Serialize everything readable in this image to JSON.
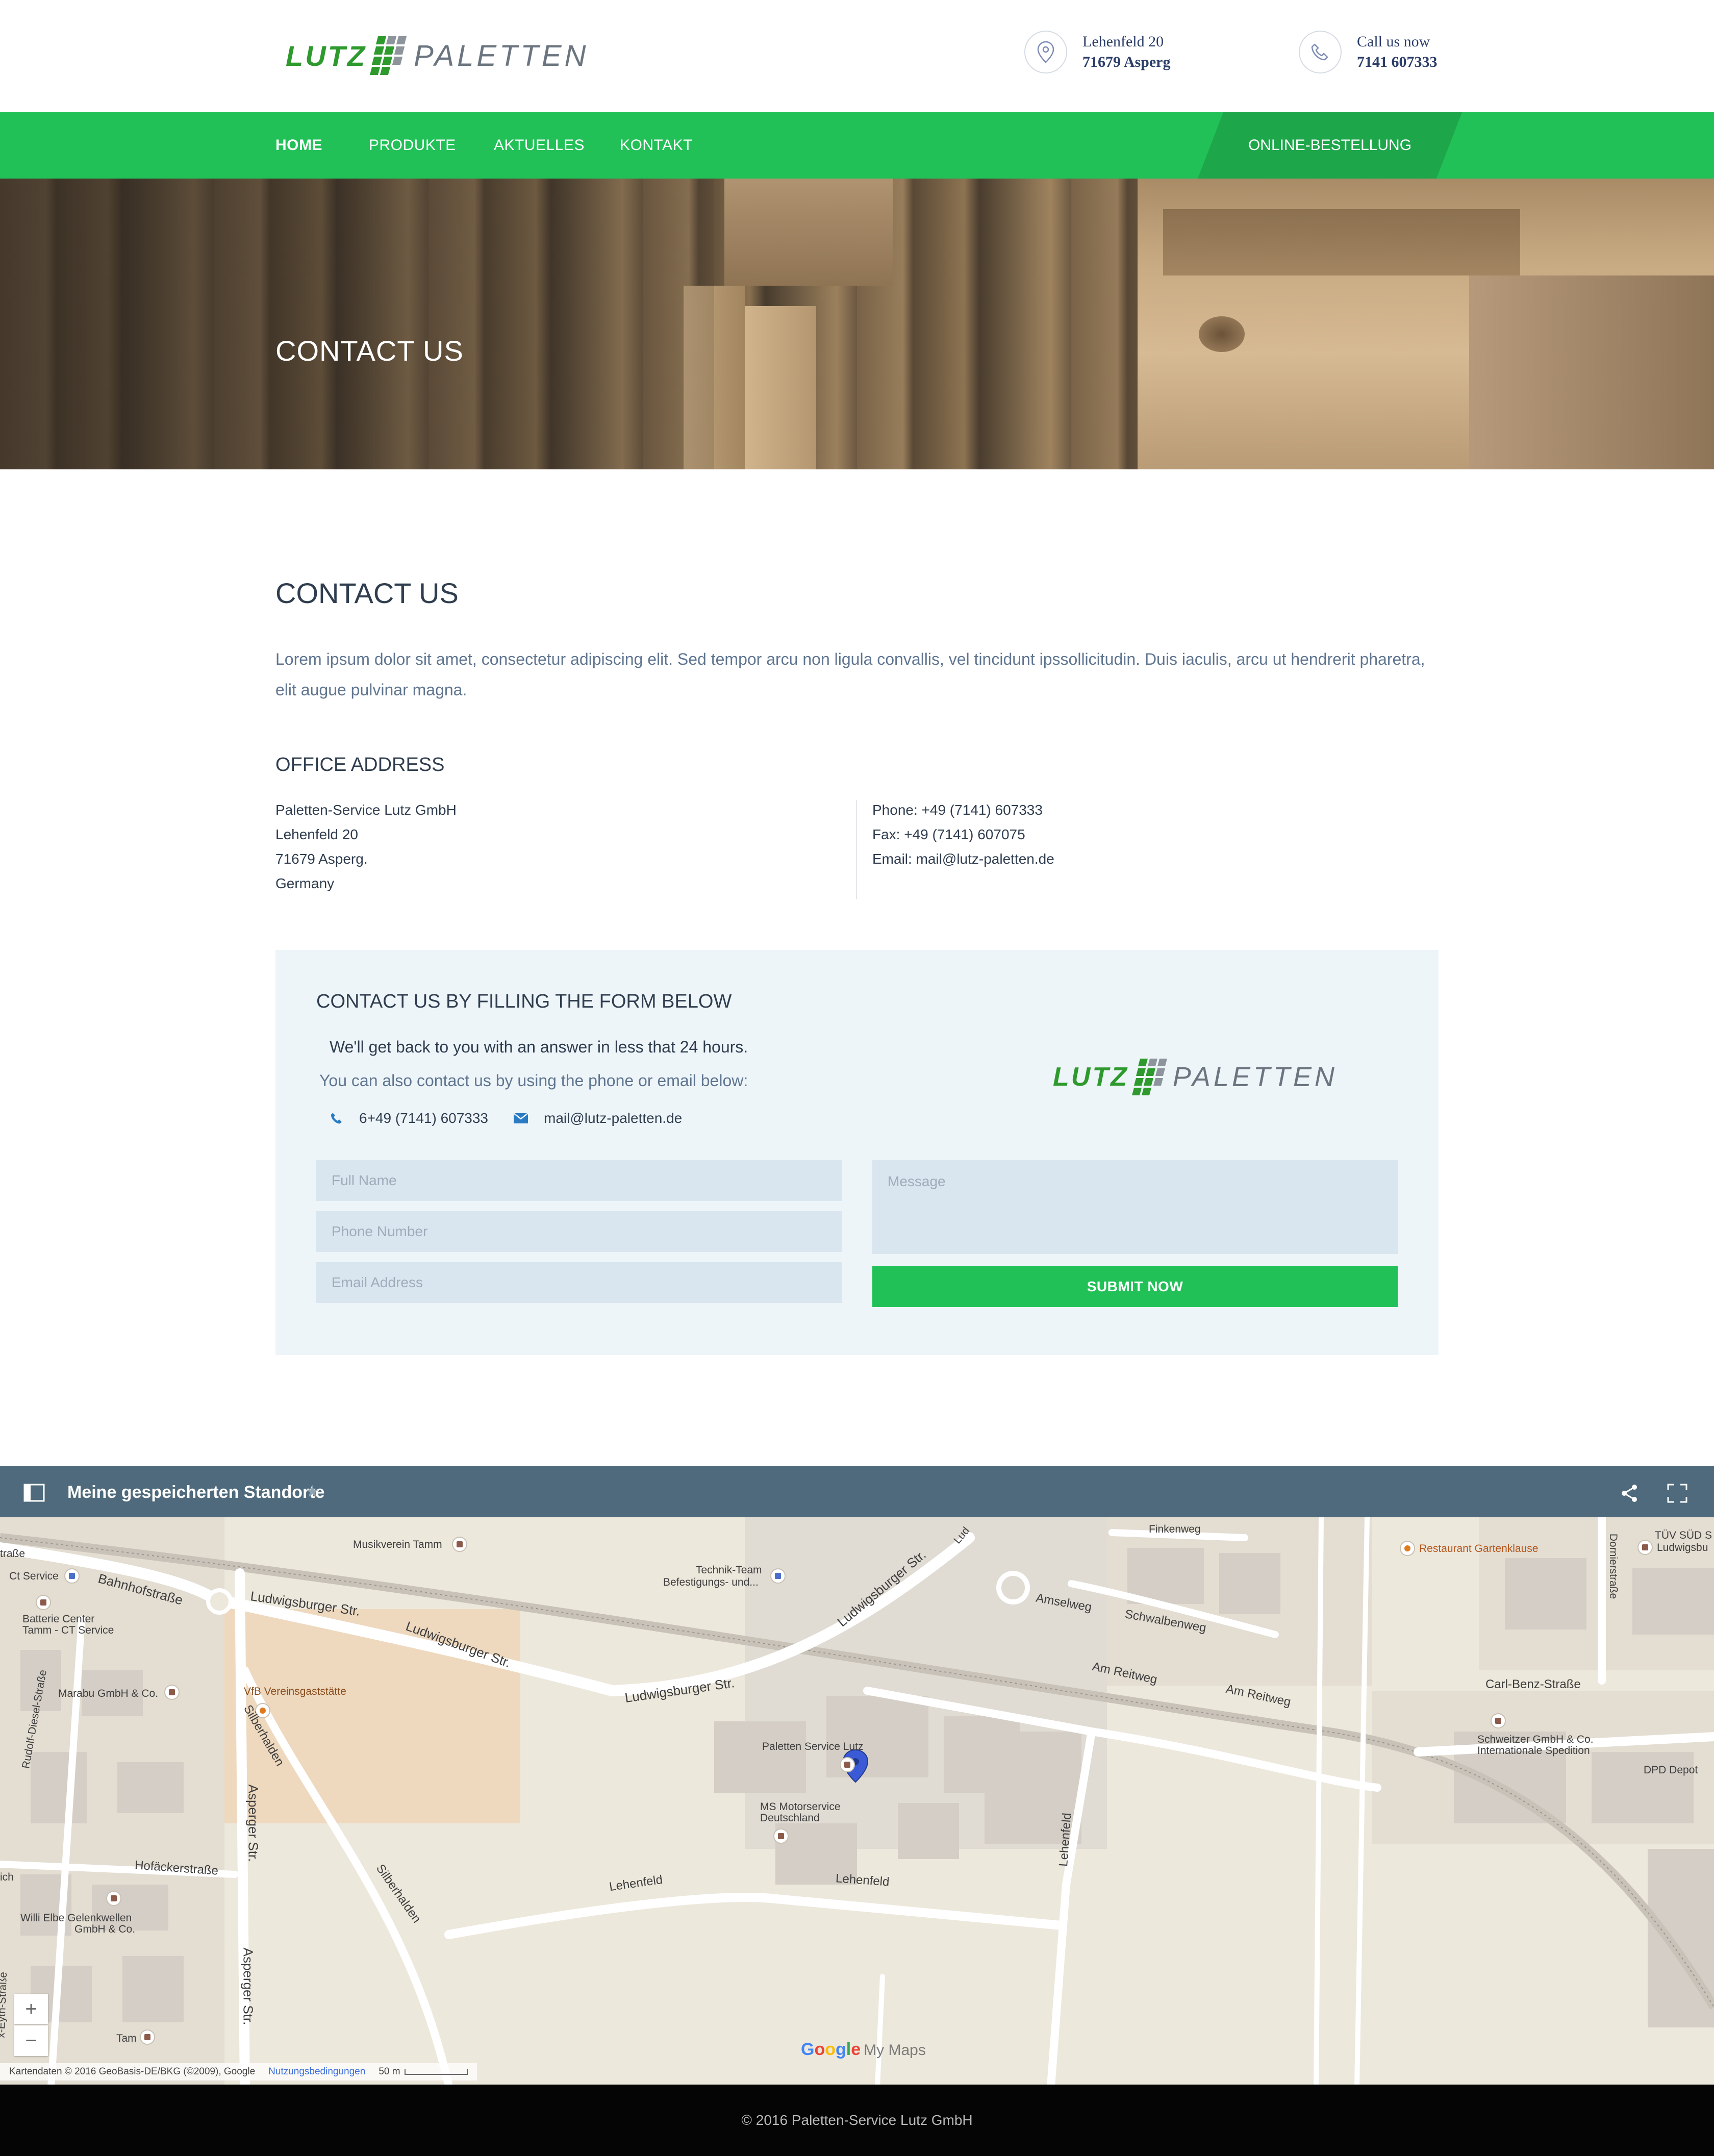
{
  "header": {
    "logo_word1": "LUTZ",
    "logo_word2": "PALETTEN",
    "address_line1": "Lehenfeld 20",
    "address_line2": "71679 Asperg",
    "call_label": "Call us now",
    "call_number": "7141 607333"
  },
  "nav": {
    "items": [
      "HOME",
      "PRODUKTE",
      "AKTUELLES",
      "KONTAKT"
    ],
    "active": "HOME",
    "cta": "ONLINE-BESTELLUNG"
  },
  "hero": {
    "title": "CONTACT US"
  },
  "content": {
    "heading": "CONTACT US",
    "intro": "Lorem ipsum dolor sit amet, consectetur adipiscing elit. Sed tempor arcu non ligula convallis, vel tincidunt ipssollicitudin. Duis iaculis, arcu ut hendrerit pharetra, elit augue pulvinar magna.",
    "office_heading": "OFFICE ADDRESS",
    "address": [
      "Paletten-Service Lutz GmbH",
      "Lehenfeld 20",
      "71679 Asperg.",
      "Germany"
    ],
    "contacts": [
      "Phone: +49 (7141) 607333",
      "Fax: +49 (7141) 607075",
      "Email: mail@lutz-paletten.de"
    ]
  },
  "form": {
    "title": "CONTACT US BY FILLING THE FORM BELOW",
    "line1": "We'll get back to you with an answer in less that 24 hours.",
    "line2": "You can also contact us by using the phone or email below:",
    "phone": "6+49 (7141) 607333",
    "email": "mail@lutz-paletten.de",
    "placeholders": {
      "full_name": "Full Name",
      "phone": "Phone Number",
      "email": "Email Address",
      "message": "Message"
    },
    "submit": "SUBMIT NOW"
  },
  "map": {
    "title": "Meine gespeicherten Standorte",
    "zoom_in": "+",
    "zoom_out": "−",
    "google_letters": [
      "G",
      "o",
      "o",
      "g",
      "l",
      "e"
    ],
    "my_maps": "My Maps",
    "attribution": "Kartendaten © 2016 GeoBasis-DE/BKG (©2009), Google",
    "terms": "Nutzungsbedingungen",
    "scale": "50 m",
    "labels": {
      "ct_service": "Ct Service",
      "bahnhofstrasse": "Bahnhofstraße",
      "musikverein": "Musikverein Tamm",
      "technik_team_1": "Technik-Team",
      "technik_team_2": "Befestigungs-  und...",
      "finkenweg": "Finkenweg",
      "restaurant": "Restaurant Gartenklause",
      "dornierstrasse": "Dornierstraße",
      "tuv_1": "TÜV SÜD S",
      "tuv_2": "Ludwigsbu",
      "batterie_1": "Batterie Center",
      "batterie_2": "Tamm - CT Service",
      "ludwigsburger_str": "Ludwigsburger Str.",
      "amselweg": "Amselweg",
      "schwalbenweg": "Schwalbenweg",
      "am_reitweg": "Am Reitweg",
      "carl_benz": "Carl-Benz-Straße",
      "marabu": "Marabu GmbH & Co.",
      "vfb": "VfB Vereinsgaststätte",
      "paletten_service": "Paletten Service Lutz",
      "schweitzer_1": "Schweitzer GmbH & Co.",
      "schweitzer_2": "Internationale Spedition",
      "dpd": "DPD Depot",
      "rudolf_diesel": "Rudolf-Diesel-Straße",
      "silberhalden": "Silberhalden",
      "asperger_str": "Asperger Str.",
      "ms_motorservice_1": "MS Motorservice",
      "ms_motorservice_2": "Deutschland",
      "hofackerstrasse": "Hofäckerstraße",
      "lehenfeld": "Lehenfeld",
      "ich": "ich",
      "willi_elbe_1": "Willi Elbe Gelenkwellen",
      "willi_elbe_2": "GmbH & Co.",
      "tam": "Tam",
      "strasse_left": "traße",
      "x_eyth": "x-Eyth-Straße",
      "lud": "Lud"
    }
  },
  "footer": {
    "copyright": "© 2016 Paletten-Service Lutz GmbH"
  },
  "colors": {
    "brand_green": "#22c158",
    "dark_green": "#1ea64b",
    "logo_green": "#2e9a2e",
    "text_dark": "#2f3d4f",
    "text_muted": "#5f7590",
    "panel_bg": "#eef5f9",
    "field_bg": "#d9e6ef",
    "map_bar": "#4e6a7c",
    "footer_bg": "#050505"
  }
}
